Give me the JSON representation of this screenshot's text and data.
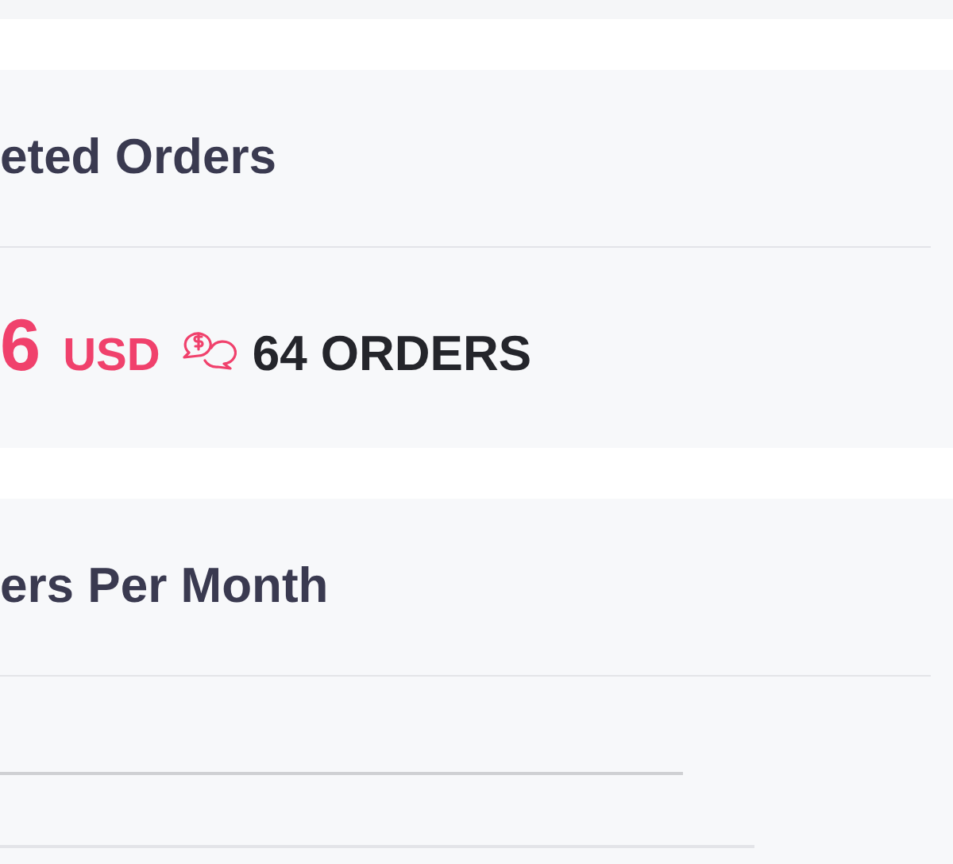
{
  "cards": [
    {
      "title": "eted Orders",
      "amount": "6",
      "currency": "USD",
      "orders": "64 ORDERS"
    },
    {
      "title": "ers Per Month"
    }
  ]
}
